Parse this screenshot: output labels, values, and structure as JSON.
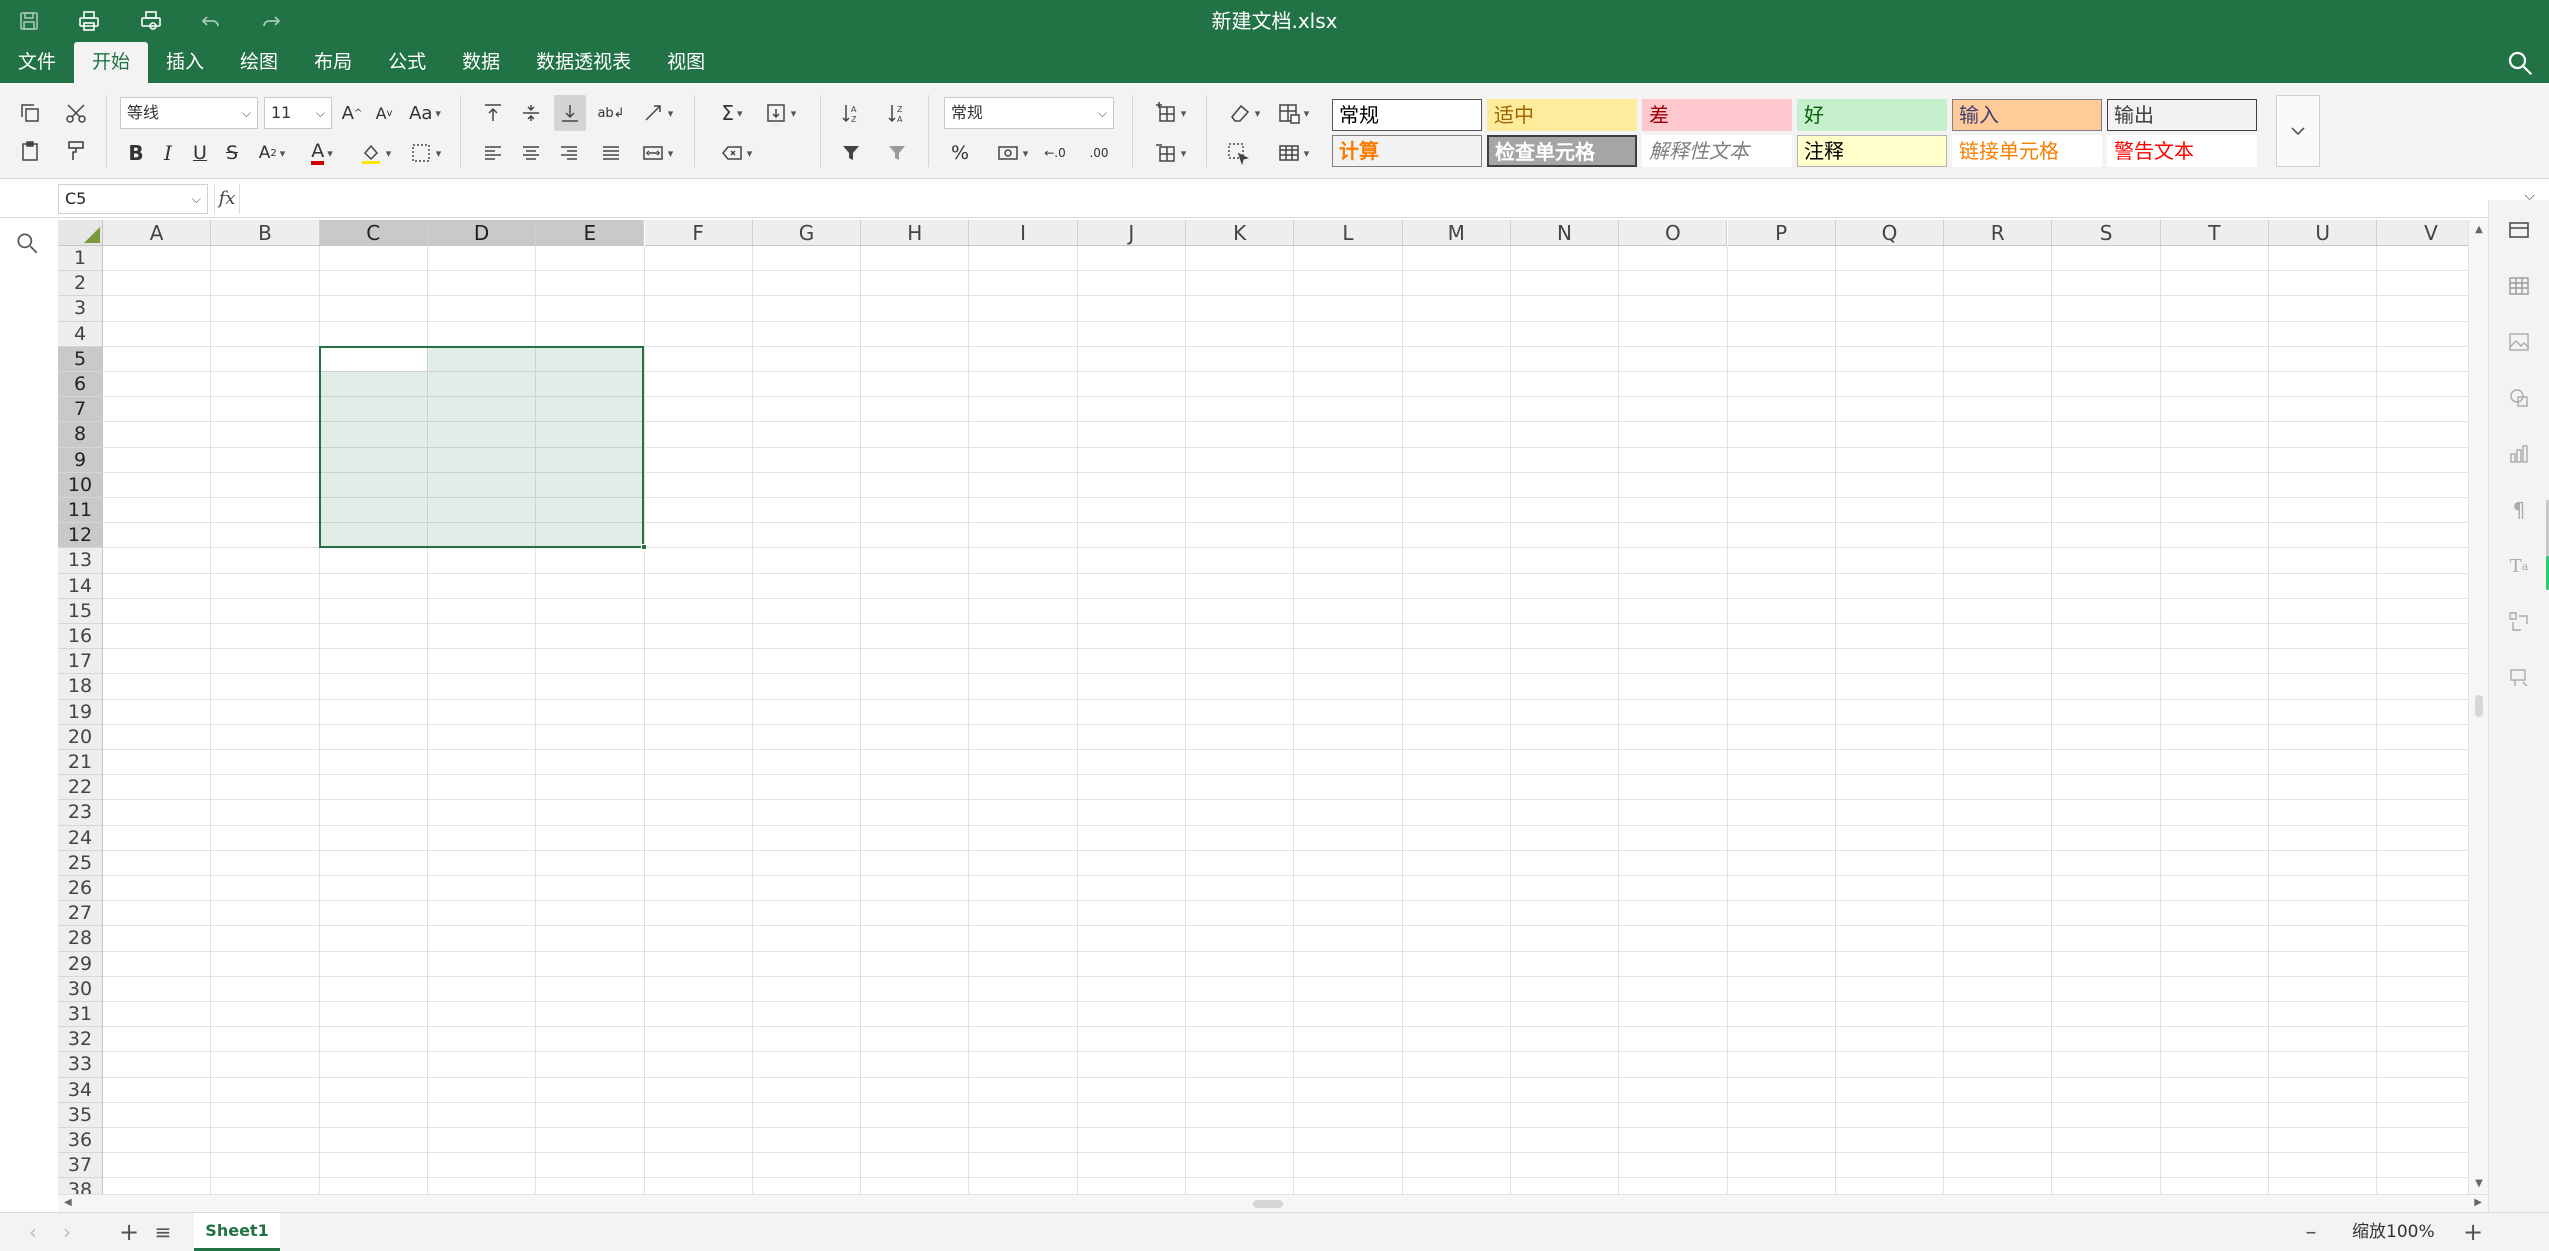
{
  "window": {
    "title": "新建文档.xlsx"
  },
  "menu": {
    "items": [
      "文件",
      "开始",
      "插入",
      "绘图",
      "布局",
      "公式",
      "数据",
      "数据透视表",
      "视图"
    ],
    "active": "开始"
  },
  "ribbon": {
    "font_name": "等线",
    "font_size": "11",
    "number_format": "常规",
    "font_color": "#d00000",
    "fill_color": "#ffe600",
    "cell_styles": [
      {
        "label": "常规",
        "bg": "#ffffff",
        "color": "#000000",
        "border": "#555555"
      },
      {
        "label": "适中",
        "bg": "#ffeb9c",
        "color": "#9c6500",
        "border": "#ffeb9c"
      },
      {
        "label": "差",
        "bg": "#ffc7ce",
        "color": "#9c0006",
        "border": "#ffc7ce"
      },
      {
        "label": "好",
        "bg": "#c6efce",
        "color": "#006100",
        "border": "#c6efce"
      },
      {
        "label": "输入",
        "bg": "#ffcc99",
        "color": "#3f3f76",
        "border": "#7f7f7f"
      },
      {
        "label": "输出",
        "bg": "#f2f2f2",
        "color": "#3f3f3f",
        "border": "#3f3f3f"
      },
      {
        "label": "计算",
        "bg": "#f2f2f2",
        "color": "#fa7d00",
        "border": "#7f7f7f"
      },
      {
        "label": "检查单元格",
        "bg": "#a5a5a5",
        "color": "#ffffff",
        "border": "#3f3f3f"
      },
      {
        "label": "解释性文本",
        "bg": "#ffffff",
        "color": "#7f7f7f",
        "border": "#ffffff"
      },
      {
        "label": "注释",
        "bg": "#ffffcc",
        "color": "#000000",
        "border": "#b2b2b2"
      },
      {
        "label": "链接单元格",
        "bg": "#ffffff",
        "color": "#fa7d00",
        "border": "#ffffff"
      },
      {
        "label": "警告文本",
        "bg": "#ffffff",
        "color": "#ff0000",
        "border": "#ffffff"
      }
    ]
  },
  "formula_bar": {
    "name_box": "C5",
    "fx_label": "fx",
    "formula": ""
  },
  "sheet": {
    "columns": [
      "A",
      "B",
      "C",
      "D",
      "E",
      "F",
      "G",
      "H",
      "I",
      "J",
      "K",
      "L",
      "M",
      "N",
      "O",
      "P",
      "Q",
      "R",
      "S",
      "T",
      "U",
      "V"
    ],
    "row_count": 38,
    "selection": {
      "from": "C5",
      "to": "E12",
      "active": "C5"
    }
  },
  "status_bar": {
    "sheet_tabs": [
      "Sheet1"
    ],
    "zoom_label": "缩放100%"
  },
  "colors": {
    "accent": "#217346",
    "header_bg": "#eeeeee",
    "header_selected_bg": "#c9c9c9"
  }
}
